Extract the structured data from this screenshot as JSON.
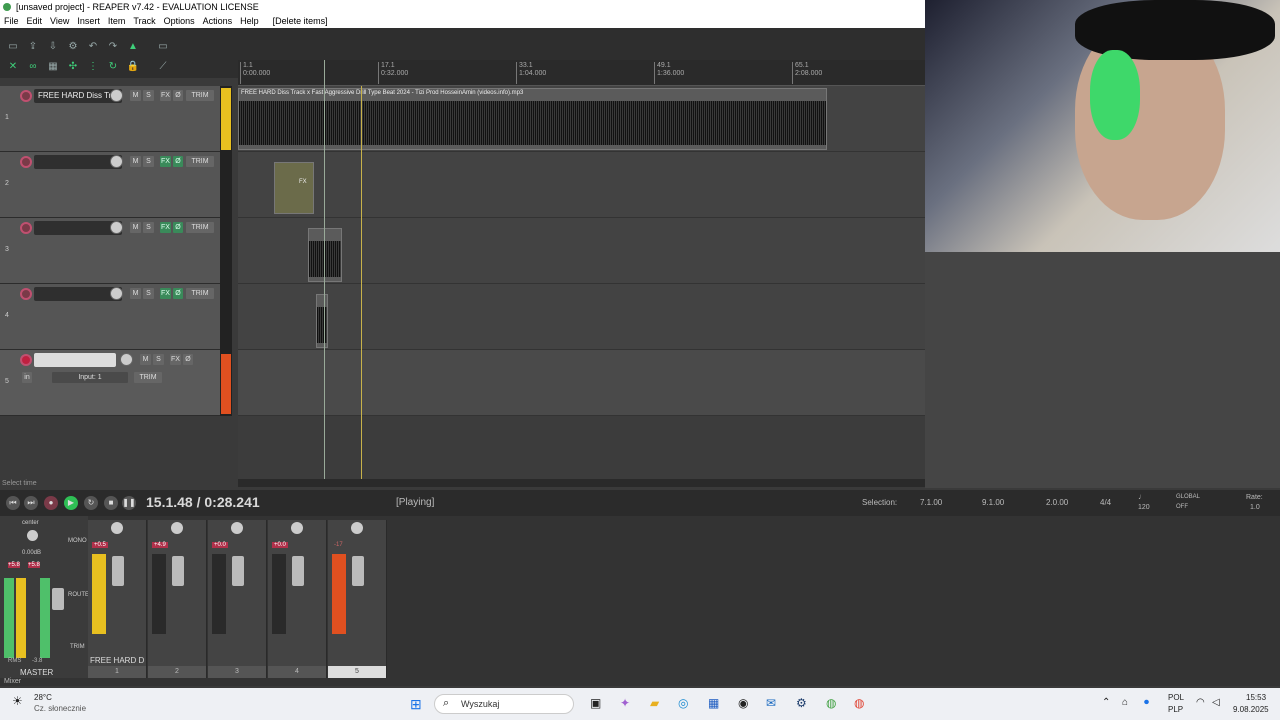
{
  "window": {
    "title": "[unsaved project] - REAPER v7.42 - EVALUATION LICENSE"
  },
  "menu": [
    "File",
    "Edit",
    "View",
    "Insert",
    "Item",
    "Track",
    "Options",
    "Actions",
    "Help",
    "[Delete items]"
  ],
  "ruler": {
    "marks": [
      {
        "bar": "1.1",
        "time": "0:00.000"
      },
      {
        "bar": "17.1",
        "time": "0:32.000"
      },
      {
        "bar": "33.1",
        "time": "1:04.000"
      },
      {
        "bar": "49.1",
        "time": "1:36.000"
      },
      {
        "bar": "65.1",
        "time": "2:08.000"
      }
    ]
  },
  "tracks": [
    {
      "number": "1",
      "name": "FREE HARD Diss Track",
      "fx_active": false
    },
    {
      "number": "2",
      "name": "",
      "fx_active": true
    },
    {
      "number": "3",
      "name": "",
      "fx_active": true
    },
    {
      "number": "4",
      "name": "",
      "fx_active": true
    },
    {
      "number": "5",
      "name": "",
      "fx_active": false,
      "input": "Input: 1",
      "in_label": "in"
    }
  ],
  "track_buttons": {
    "mute": "M",
    "solo": "S",
    "fx": "FX",
    "trim": "TRIM",
    "phase": "Ø"
  },
  "items": {
    "main_label": "FREE HARD Diss Track x Fast Aggressive Drill Type Beat 2024 - Tizi Prod HosseinAmin (videos.info).mp3",
    "fx_label": "FX"
  },
  "status": {
    "select_time": "Select time"
  },
  "transport": {
    "position": "15.1.48 / 0:28.241",
    "state": "[Playing]",
    "selection_label": "Selection:",
    "selection_start": "7.1.00",
    "selection_end": "9.1.00",
    "selection_length": "2.0.00",
    "time_sig": "4/4",
    "bpm": "120",
    "global_label": "GLOBAL",
    "global_state": "OFF",
    "rate_label": "Rate:",
    "rate_value": "1.0"
  },
  "mixer": {
    "master_label": "MASTER",
    "center_label": "center",
    "master_vol": "0.00dB",
    "master_peak_left": "+5.8",
    "master_peak_right": "+5.8",
    "rms_label": "RMS",
    "rms_value": "-3.8",
    "mono_label": "MONO",
    "route_label": "ROUTE",
    "trim_label": "TRIM",
    "mixer_tab": "Mixer",
    "strip_name": "FREE HARD D",
    "strips": [
      {
        "number": "1",
        "peak": "+0.5"
      },
      {
        "number": "2",
        "peak": "+4.9"
      },
      {
        "number": "3",
        "peak": "+0.0"
      },
      {
        "number": "4",
        "peak": "+0.0"
      },
      {
        "number": "5",
        "peak": "-17"
      }
    ]
  },
  "taskbar": {
    "temp": "28°C",
    "weather": "Cz. słonecznie",
    "search_placeholder": "Wyszukaj",
    "lang_top": "POL",
    "lang_bottom": "PLP",
    "time": "15:53",
    "date": "9.08.2025"
  },
  "colors": {
    "accent_green": "#3fcf7a",
    "record_red": "#c05070",
    "meter_yellow": "#e8c020",
    "meter_orange": "#e05020"
  }
}
